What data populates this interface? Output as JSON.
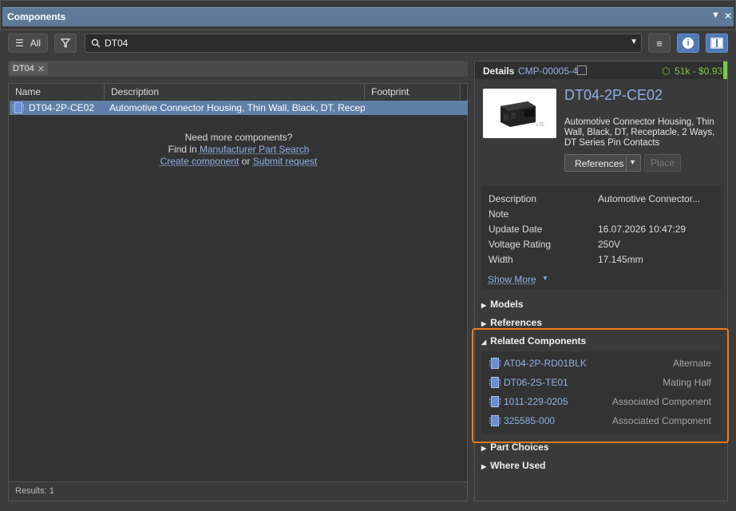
{
  "window": {
    "title": "Components"
  },
  "toolbar": {
    "all_label": "All",
    "search_value": "DT04"
  },
  "filter": {
    "chip_label": "DT04"
  },
  "list": {
    "columns": [
      "Name",
      "Description",
      "Footprint"
    ],
    "rows": [
      {
        "name": "DT04-2P-CE02",
        "description": "Automotive Connector Housing, Thin Wall, Black, DT, Recept..."
      }
    ],
    "empty_prompt": "Need more components?",
    "find_in": "Find in",
    "manufacturer_link": "Manufacturer Part Search",
    "create_link": "Create component",
    "or_text": "or",
    "submit_link": "Submit request",
    "results": "Results: 1"
  },
  "details": {
    "tab_label": "Details",
    "component_id": "CMP-00005-4",
    "stock_price": "51k - $0.93",
    "part_name": "DT04-2P-CE02",
    "part_description": "Automotive Connector Housing, Thin Wall, Black, DT, Receptacle, 2 Ways, DT Series Pin Contacts",
    "references_button": "References",
    "place_button": "Place",
    "properties": [
      {
        "label": "Description",
        "value": "Automotive Connector..."
      },
      {
        "label": "Note",
        "value": ""
      },
      {
        "label": "Update Date",
        "value": "16.07.2026 10:47:29"
      },
      {
        "label": "Voltage Rating",
        "value": "250V"
      },
      {
        "label": "Width",
        "value": "17.145mm"
      }
    ],
    "show_more": "Show More",
    "sections": {
      "models": "Models",
      "references": "References",
      "related": "Related Components",
      "part_choices": "Part Choices",
      "where_used": "Where Used"
    },
    "related_components": [
      {
        "name": "AT04-2P-RD01BLK",
        "type": "Alternate"
      },
      {
        "name": "DT06-2S-TE01",
        "type": "Mating Half"
      },
      {
        "name": "1011-229-0205",
        "type": "Associated Component"
      },
      {
        "name": "325585-000",
        "type": "Associated Component"
      }
    ]
  },
  "colors": {
    "accent": "#4f79b7",
    "highlight_border": "#f07a1a",
    "link": "#8fb2e6",
    "stock_green": "#7ac943"
  }
}
